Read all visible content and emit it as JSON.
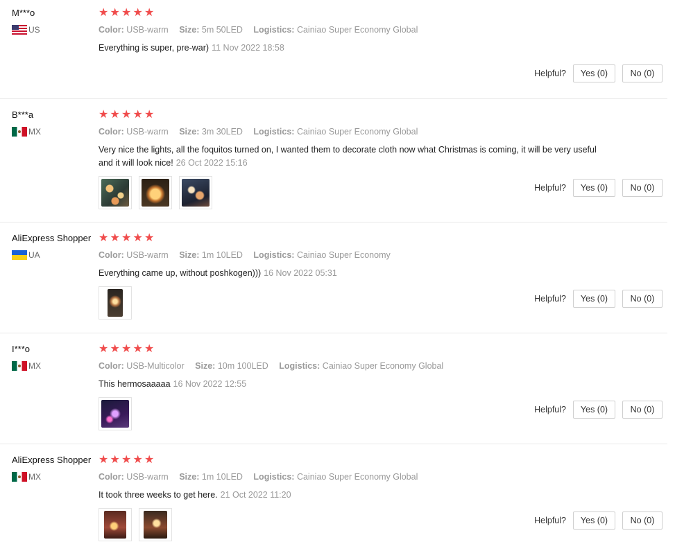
{
  "labels": {
    "color_key": "Color:",
    "size_key": "Size:",
    "logistics_key": "Logistics:",
    "helpful": "Helpful?",
    "yes": "Yes (0)",
    "no": "No (0)"
  },
  "reviews": [
    {
      "user": "M***o",
      "country": "US",
      "rating": 5,
      "color": "USB-warm",
      "size": "5m 50LED",
      "logistics": "Cainiao Super Economy Global",
      "text": "Everything is super, pre-war)",
      "date": "11 Nov 2022 18:58",
      "photos": 0
    },
    {
      "user": "B***a",
      "country": "MX",
      "rating": 5,
      "color": "USB-warm",
      "size": "3m 30LED",
      "logistics": "Cainiao Super Economy Global",
      "text": "Very nice the lights, all the foquitos turned on, I wanted them to decorate cloth now what Christmas is coming, it will be very useful and it will look nice!",
      "date": "26 Oct 2022 15:16",
      "photos": 3
    },
    {
      "user": "AliExpress Shopper",
      "country": "UA",
      "rating": 5,
      "color": "USB-warm",
      "size": "1m 10LED",
      "logistics": "Cainiao Super Economy",
      "text": "Everything came up, without poshkogen)))",
      "date": "16 Nov 2022 05:31",
      "photos": 1
    },
    {
      "user": "I***o",
      "country": "MX",
      "rating": 5,
      "color": "USB-Multicolor",
      "size": "10m 100LED",
      "logistics": "Cainiao Super Economy Global",
      "text": "This hermosaaaaa",
      "date": "16 Nov 2022 12:55",
      "photos": 1
    },
    {
      "user": "AliExpress Shopper",
      "country": "MX",
      "rating": 5,
      "color": "USB-warm",
      "size": "1m 10LED",
      "logistics": "Cainiao Super Economy Global",
      "text": "It took three weeks to get here.",
      "date": "21 Oct 2022 11:20",
      "photos": 2
    }
  ]
}
